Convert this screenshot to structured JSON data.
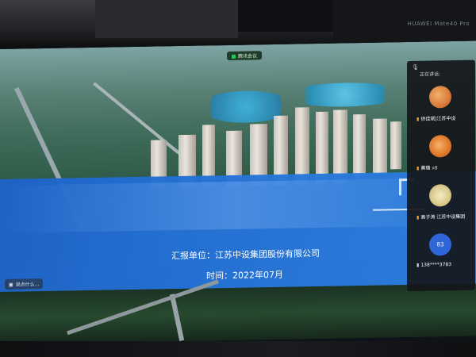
{
  "device": {
    "bezel_label": "HUAWEI Mate40 Pro"
  },
  "meeting": {
    "top_indicator": "腾讯会议",
    "speaking_label": "正在讲话:",
    "chip_label": "说点什么..."
  },
  "slide": {
    "report_unit": "汇报单位：江苏中设集团股份有限公司",
    "time": "时间：2022年07月"
  },
  "participants": [
    {
      "name": "徐佳斌|江苏中设",
      "avatar_color": "#d97b3b"
    },
    {
      "name": "黄璐",
      "suffix": "x8",
      "avatar_color": "#e07a2a"
    },
    {
      "name": "高子涛 江苏中设集团",
      "avatar_color": "#d9c98a"
    },
    {
      "avatar_text": "83",
      "name": "138****3783",
      "avatar_color": "#2f67d8"
    }
  ],
  "colors": {
    "banner": "#2573d8",
    "panel": "#14161a"
  }
}
